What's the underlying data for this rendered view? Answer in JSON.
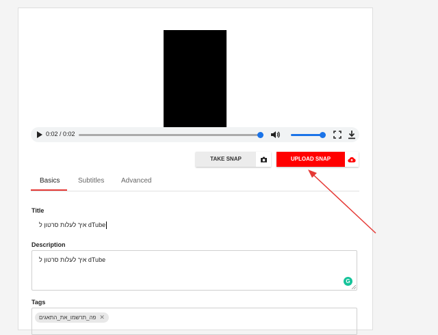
{
  "player": {
    "time": "0:02 / 0:02",
    "progress": 1.0,
    "volume": 1.0
  },
  "snap": {
    "take_label": "TAKE SNAP",
    "upload_label": "UPLOAD SNAP"
  },
  "tabs": [
    {
      "label": "Basics",
      "active": true
    },
    {
      "label": "Subtitles",
      "active": false
    },
    {
      "label": "Advanced",
      "active": false
    }
  ],
  "form": {
    "title_label": "Title",
    "title_value": "איך לעלות סרטון ל dTube",
    "description_label": "Description",
    "description_value": "איך לעלות סרטון ל dTube",
    "tags_label": "Tags",
    "tags": [
      "פה_תרשמו_את_התאגים"
    ]
  },
  "colors": {
    "accent_red": "#ff0000",
    "player_blue": "#1a73e8",
    "annotation_red": "#e53935"
  },
  "icons": {
    "play": "play-icon",
    "volume": "volume-icon",
    "fullscreen": "fullscreen-icon",
    "download": "download-icon",
    "camera": "camera-icon",
    "cloud_upload": "cloud-upload-icon",
    "grammarly": "grammarly-icon"
  }
}
